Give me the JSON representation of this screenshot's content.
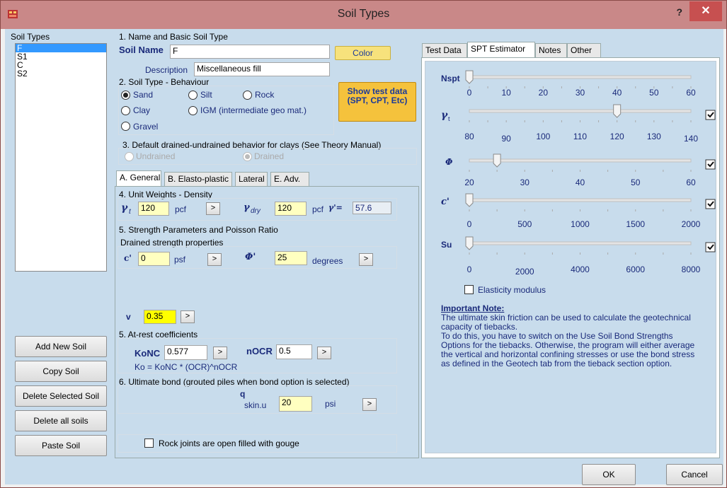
{
  "window": {
    "title": "Soil Types",
    "help": "?",
    "close": "✕"
  },
  "soil_list": {
    "header": "Soil Types",
    "items": [
      "F",
      "S1",
      "C",
      "S2"
    ],
    "selected": "F"
  },
  "left_buttons": [
    "Add New Soil",
    "Copy Soil",
    "Delete Selected Soil",
    "Delete all soils",
    "Paste Soil"
  ],
  "section1": {
    "title": "1. Name and Basic Soil Type",
    "soil_name_label": "Soil Name",
    "soil_name": "F",
    "color_label": "Color",
    "desc_label": "Description",
    "description": "Miscellaneous fill"
  },
  "section2": {
    "title": "2. Soil Type - Behaviour",
    "options": {
      "sand": "Sand",
      "silt": "Silt",
      "rock": "Rock",
      "clay": "Clay",
      "igm": "IGM (intermediate geo mat.)",
      "gravel": "Gravel"
    },
    "show_test": "Show test data (SPT, CPT, Etc)"
  },
  "section3": {
    "title": "3. Default drained-undrained behavior for clays (See Theory Manual)",
    "undrained": "Undrained",
    "drained": "Drained"
  },
  "lower_tabs": [
    "A. General",
    "B. Elasto-plastic",
    "Lateral",
    "E. Adv."
  ],
  "general": {
    "s4": "4. Unit Weights - Density",
    "gt_sym": "γ",
    "gt_sub": "t",
    "gt_val": "120",
    "gt_unit": "pcf",
    "gd_sym": "γ",
    "gd_sub": "dry",
    "gd_val": "120",
    "gd_unit": "pcf",
    "gp_sym": "γ'=",
    "gp_val": "57.6",
    "s5": "5. Strength Parameters and Poisson Ratio",
    "drained_title": "Drained strength properties",
    "c_label": "c'",
    "c_val": "0",
    "c_unit": "psf",
    "phi_label": "Φ'",
    "phi_val": "25",
    "phi_unit": "degrees",
    "v_label": "v",
    "v_val": "0.35",
    "s5b": "5. At-rest coefficients",
    "konc_label": "KoNC",
    "konc_val": "0.577",
    "nocr_label": "nOCR",
    "nocr_val": "0.5",
    "ko_formula": "Ko = KoNC * (OCR)^nOCR",
    "s6": "6. Ultimate bond (grouted piles when bond option is selected)",
    "q_label": "q",
    "q_sub": "skin.u",
    "q_val": "20",
    "q_unit": "psi",
    "rock_joints": "Rock joints are open filled with gouge",
    "more": ">"
  },
  "right_tabs": [
    "Test Data",
    "SPT Estimator",
    "Notes",
    "Other"
  ],
  "spt": {
    "nspt": {
      "label": "Nspt",
      "ticks": [
        "0",
        "10",
        "20",
        "30",
        "40",
        "50",
        "60"
      ],
      "value": 0
    },
    "gamma": {
      "label": "γ",
      "sub": "t",
      "ticks": [
        "80",
        "90",
        "100",
        "110",
        "120",
        "130",
        "140"
      ],
      "value": 120,
      "checked": true
    },
    "phi": {
      "label": "Φ",
      "ticks": [
        "20",
        "30",
        "40",
        "50",
        "60"
      ],
      "value": 25,
      "checked": true
    },
    "c": {
      "label": "c'",
      "ticks": [
        "0",
        "500",
        "1000",
        "1500",
        "2000"
      ],
      "value": 0,
      "checked": true
    },
    "su": {
      "label": "Su",
      "ticks": [
        "0",
        "2000",
        "4000",
        "6000",
        "8000"
      ],
      "value": 0,
      "checked": true
    },
    "elasticity": "Elasticity modulus",
    "note_title": "Important Note:",
    "note_lines": [
      "The ultimate skin friction can be used to calculate the geotechnical",
      "capacity of tiebacks.",
      "To do this, you have to switch on the Use Soil Bond Strengths",
      "Options for the tiebacks. Otherwise, the program will either average",
      "the vertical and horizontal confining stresses or use the bond stress",
      "as defined in the Geotech tab from the tieback section option."
    ]
  },
  "footer": {
    "ok": "OK",
    "cancel": "Cancel"
  },
  "colors": {
    "titlebar": "#c98888",
    "client": "#c8dcec",
    "close": "#c75050",
    "color_btn": "#f7e27c",
    "show_test_btn": "#f5c23c"
  }
}
